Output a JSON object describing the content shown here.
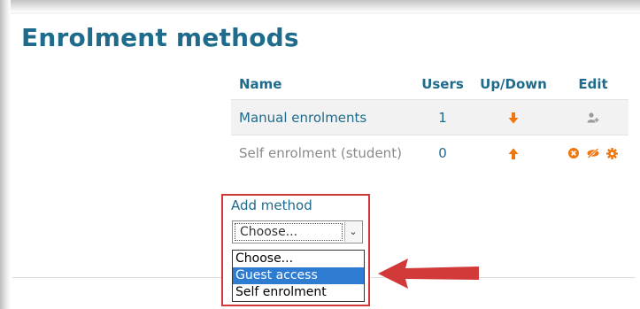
{
  "page": {
    "title": "Enrolment methods"
  },
  "table": {
    "headers": {
      "name": "Name",
      "users": "Users",
      "updown": "Up/Down",
      "edit": "Edit"
    },
    "rows": [
      {
        "name": "Manual enrolments",
        "users": "1",
        "enabled": true
      },
      {
        "name": "Self enrolment (student)",
        "users": "0",
        "enabled": false
      }
    ]
  },
  "add_method": {
    "label": "Add method",
    "selected": "Choose...",
    "options": [
      "Choose...",
      "Guest access",
      "Self enrolment"
    ],
    "highlighted": "Guest access"
  },
  "colors": {
    "title": "#1f6b8c",
    "accent_orange": "#f0760f",
    "annotation_red": "#d23a3a",
    "option_highlight": "#2e7bd2"
  },
  "icons": {
    "move_down": "arrow-down-icon",
    "move_up": "arrow-up-icon",
    "enrol_users": "add-user-icon",
    "delete": "delete-icon",
    "disable": "hide-icon",
    "settings": "gear-icon"
  }
}
